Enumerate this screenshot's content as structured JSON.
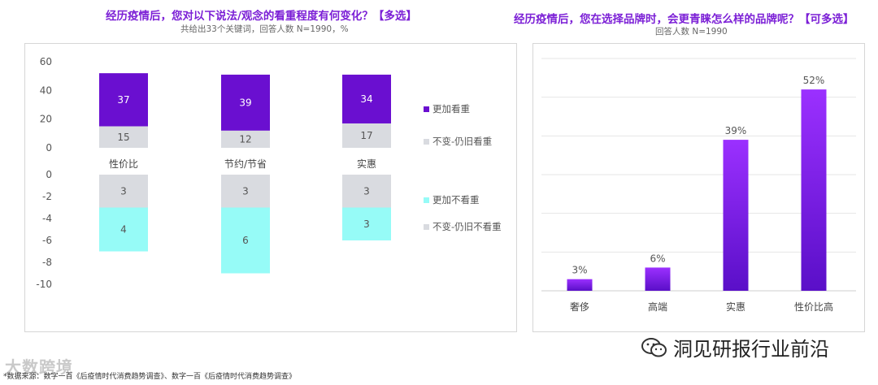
{
  "left": {
    "title": "经历疫情后，您对以下说法/观念的看重程度有何变化？【多选】",
    "subtitle": "共给出33个关键词，回答人数 N=1990，%"
  },
  "right": {
    "title": "经历疫情后，您在选择品牌时，会更青睐怎么样的品牌呢？【可多选】",
    "subtitle": "回答人数 N=1990"
  },
  "chart_data": [
    {
      "type": "bar",
      "categories": [
        "性价比",
        "节约/节省",
        "实惠"
      ],
      "title": "经历疫情后，您对以下说法/观念的看重程度有何变化？【多选】",
      "subtitle": "共给出33个关键词，回答人数 N=1990，%",
      "upper": {
        "ylim": [
          0,
          60
        ],
        "yticks": [
          "60",
          "40",
          "20",
          "0"
        ],
        "series": [
          {
            "name": "不变-仍旧看重",
            "values": [
              15,
              12,
              17
            ],
            "color": "#d9dbe0"
          },
          {
            "name": "更加看重",
            "values": [
              37,
              39,
              34
            ],
            "color": "#6a0fd0"
          }
        ]
      },
      "lower": {
        "ylim": [
          -10,
          0
        ],
        "yticks": [
          "0",
          "-2",
          "-4",
          "-6",
          "-8",
          "-10"
        ],
        "series": [
          {
            "name": "不变-仍旧不看重",
            "values": [
              3,
              3,
              3
            ],
            "color": "#d9dbe0"
          },
          {
            "name": "更加不看重",
            "values": [
              4,
              6,
              3
            ],
            "color": "#96fbf7"
          }
        ]
      },
      "legend": [
        {
          "name": "更加看重",
          "color": "#6a0fd0"
        },
        {
          "name": "不变-仍旧看重",
          "color": "#d9dbe0"
        },
        {
          "name": "更加不看重",
          "color": "#96fbf7"
        },
        {
          "name": "不变-仍旧不看重",
          "color": "#d9dbe0"
        }
      ]
    },
    {
      "type": "bar",
      "title": "经历疫情后，您在选择品牌时，会更青睐怎么样的品牌呢？【可多选】",
      "subtitle": "回答人数 N=1990",
      "categories": [
        "奢侈",
        "高端",
        "实惠",
        "性价比高"
      ],
      "values": [
        3,
        6,
        39,
        52
      ],
      "value_labels": [
        "3%",
        "6%",
        "39%",
        "52%"
      ],
      "ylim": [
        0,
        60
      ],
      "grid": true,
      "colors": [
        "#8a2be2",
        "#5a0fc8"
      ]
    }
  ],
  "footer": {
    "source": "*数据来源：数字一百《后疫情时代消费趋势调查》、数字一百《后疫情时代消费趋势调查》",
    "watermark": "大数跨境",
    "wechat": "洞见研报行业前沿"
  }
}
